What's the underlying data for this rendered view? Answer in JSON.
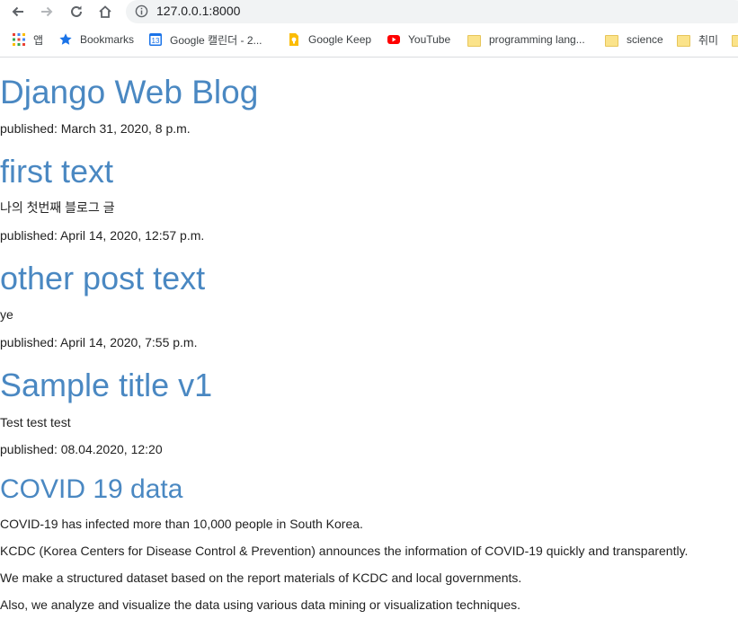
{
  "browser": {
    "url": "127.0.0.1:8000",
    "bookmarks": [
      {
        "label": "앱",
        "icon": "apps-grid-icon"
      },
      {
        "label": "Bookmarks",
        "icon": "star-icon"
      },
      {
        "label": "Google 캘린더 - 2...",
        "icon": "google-calendar-icon"
      },
      {
        "label": "Google Keep",
        "icon": "google-keep-icon"
      },
      {
        "label": "YouTube",
        "icon": "youtube-icon"
      },
      {
        "label": "programming lang...",
        "icon": "folder-icon"
      },
      {
        "label": "science",
        "icon": "folder-icon"
      },
      {
        "label": "취미",
        "icon": "folder-icon"
      }
    ],
    "calendar_day": "13"
  },
  "blog": {
    "title": "Django Web Blog",
    "published": "published: March 31, 2020, 8 p.m."
  },
  "posts": [
    {
      "title": "first text",
      "body": [
        "나의 첫번째 블로그 글"
      ],
      "published": "published: April 14, 2020, 12:57 p.m."
    },
    {
      "title": "other post text",
      "body": [
        "ye"
      ],
      "published": "published: April 14, 2020, 7:55 p.m."
    },
    {
      "title": "Sample title v1",
      "body": [
        "Test test test"
      ],
      "published": "published: 08.04.2020, 12:20"
    },
    {
      "title": "COVID 19 data",
      "body": [
        "COVID-19 has infected more than 10,000 people in South Korea.",
        "KCDC (Korea Centers for Disease Control & Prevention) announces the information of COVID-19 quickly and transparently.",
        "We make a structured dataset based on the report materials of KCDC and local governments.",
        "Also, we analyze and visualize the data using various data mining or visualization techniques."
      ],
      "published": ""
    }
  ],
  "colors": {
    "link_title": "#4a88c2",
    "text": "#222222"
  }
}
